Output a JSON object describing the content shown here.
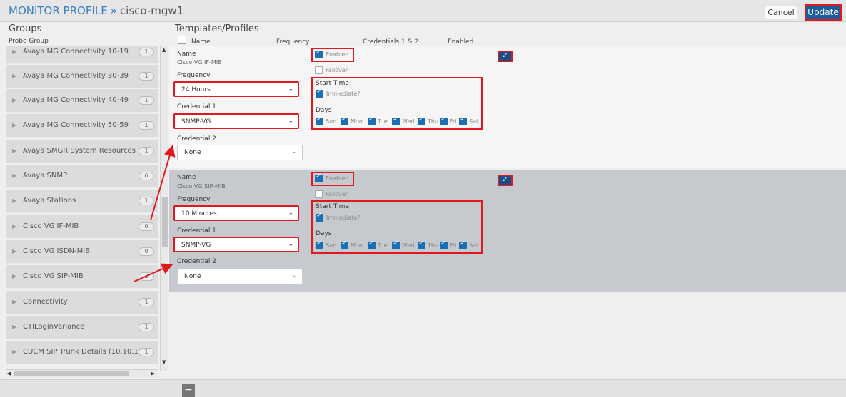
{
  "header": {
    "title": "MONITOR PROFILE",
    "separator": "»",
    "device": "cisco-mgw1",
    "cancel_label": "Cancel",
    "update_label": "Update"
  },
  "groups": {
    "title": "Groups",
    "column_label": "Probe Group",
    "items": [
      {
        "label": "Avaya MG Connectivity 10-19",
        "count": "1"
      },
      {
        "label": "Avaya MG Connectivity 30-39",
        "count": "1"
      },
      {
        "label": "Avaya MG Connectivity 40-49",
        "count": "1"
      },
      {
        "label": "Avaya MG Connectivity 50-59",
        "count": "1"
      },
      {
        "label": "Avaya SMGR System Resources",
        "count": "1"
      },
      {
        "label": "Avaya SNMP",
        "count": "6"
      },
      {
        "label": "Avaya Stations",
        "count": "1"
      },
      {
        "label": "Cisco VG IF-MIB",
        "count": "0"
      },
      {
        "label": "Cisco VG ISDN-MIB",
        "count": "0"
      },
      {
        "label": "Cisco VG SIP-MIB",
        "count": "2"
      },
      {
        "label": "Connectivity",
        "count": "1"
      },
      {
        "label": "CTILoginVariance",
        "count": "1"
      },
      {
        "label": "CUCM SIP Trunk Details (10.10.10....",
        "count": "1"
      }
    ]
  },
  "templates": {
    "title": "Templates/Profiles",
    "columns": {
      "name": "Name",
      "frequency": "Frequency",
      "credentials": "Credentials 1 & 2",
      "enabled": "Enabled"
    }
  },
  "labels": {
    "name": "Name",
    "frequency": "Frequency",
    "credential1": "Credential 1",
    "credential2": "Credential 2",
    "enabled": "Enabled",
    "failover": "Failover",
    "start_time": "Start Time",
    "immediate": "Immediate?",
    "days": "Days",
    "sun": "Sun",
    "mon": "Mon",
    "tue": "Tue",
    "wed": "Wed",
    "thu": "Thu",
    "fri": "Fri",
    "sat": "Sat"
  },
  "profiles": [
    {
      "name": "Cisco VG IF-MIB",
      "frequency": "24 Hours",
      "credential1": "SNMP-VG",
      "credential2": "None",
      "enabled": true,
      "failover": false,
      "immediate": true
    },
    {
      "name": "Cisco VG SIP-MIB",
      "frequency": "10 Minutes",
      "credential1": "SNMP-VG",
      "credential2": "None",
      "enabled": true,
      "failover": false,
      "immediate": true
    }
  ],
  "colors": {
    "accent": "#1a5c9c",
    "highlight": "#e0191f",
    "checkbox": "#1b6fb5"
  }
}
